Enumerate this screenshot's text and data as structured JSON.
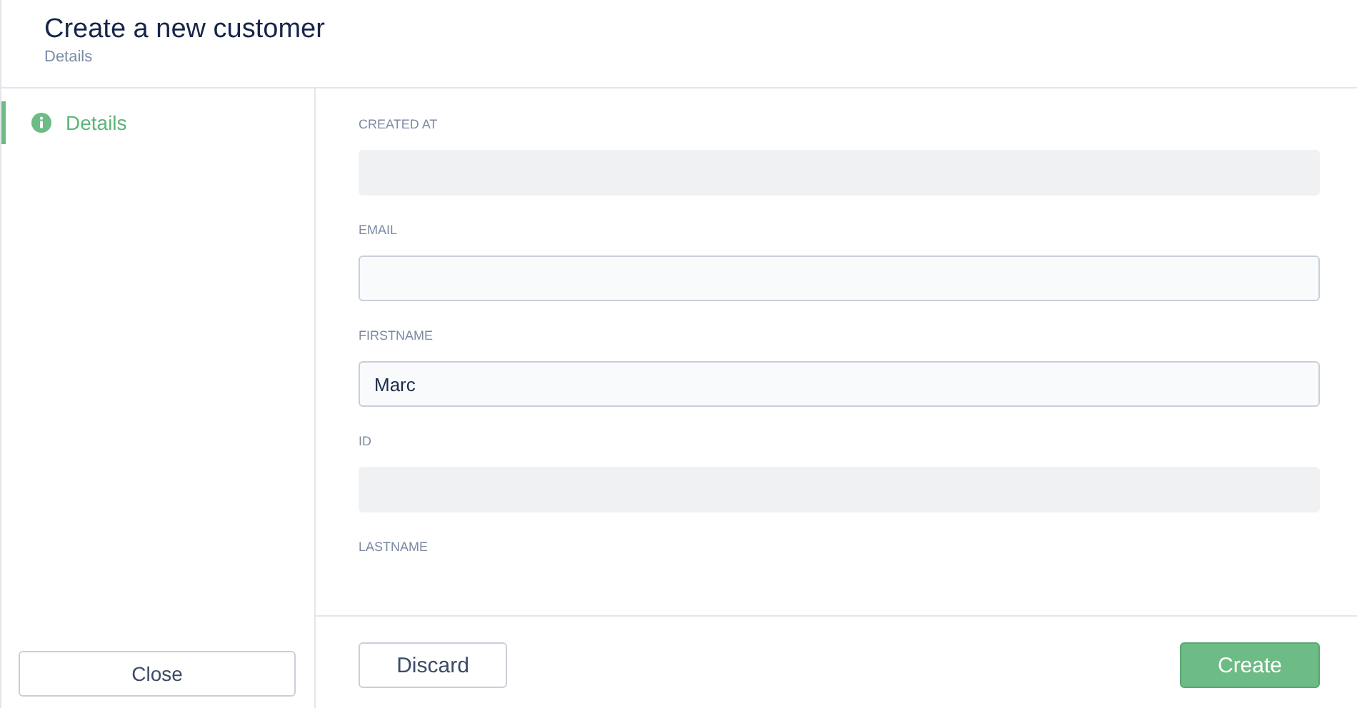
{
  "header": {
    "title": "Create a new customer",
    "subtitle": "Details"
  },
  "sidebar": {
    "items": [
      {
        "label": "Details",
        "selected": true
      }
    ],
    "close_button": "Close"
  },
  "form": {
    "fields": [
      {
        "label": "CREATED AT",
        "disabled": true
      },
      {
        "label": "EMAIL",
        "disabled": false
      },
      {
        "label": "FIRSTNAME",
        "disabled": false,
        "value": "Marc"
      },
      {
        "label": "ID",
        "disabled": true
      },
      {
        "label": "LASTNAME"
      }
    ]
  },
  "footer": {
    "discard_button": "Discard",
    "create_button": "Create"
  }
}
